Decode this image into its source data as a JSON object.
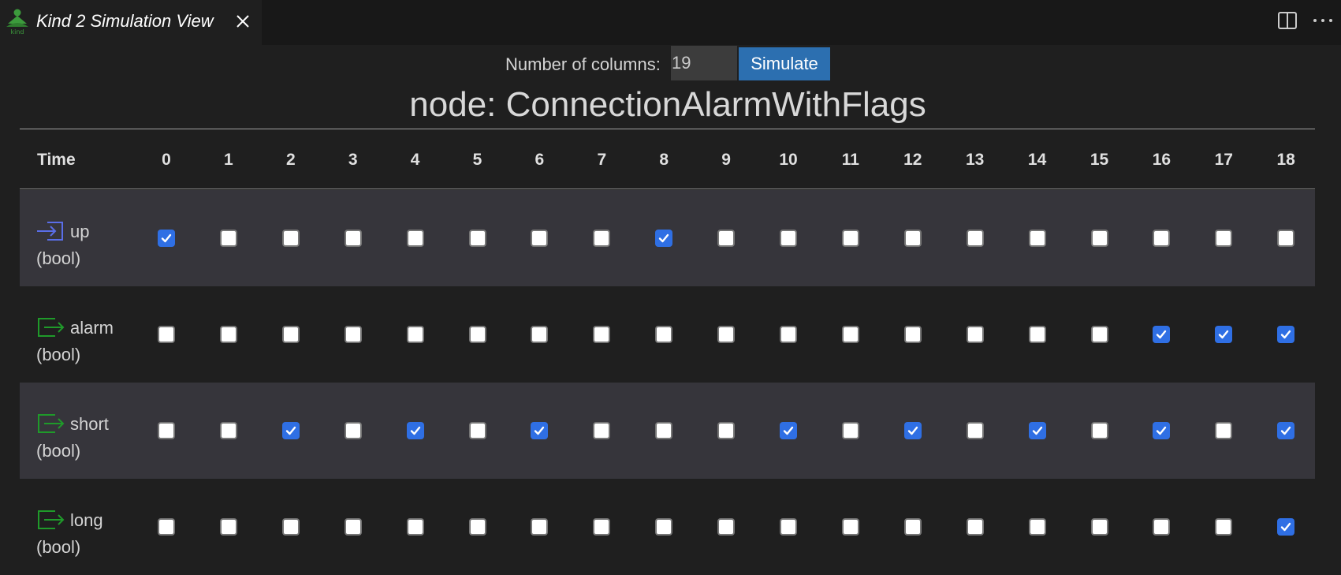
{
  "tab": {
    "title": "Kind 2 Simulation View",
    "logo_text": "kind"
  },
  "controls": {
    "label": "Number of columns:",
    "columns_value": "19",
    "simulate_label": "Simulate"
  },
  "node_title": "node: ConnectionAlarmWithFlags",
  "table": {
    "time_label": "Time",
    "columns": [
      "0",
      "1",
      "2",
      "3",
      "4",
      "5",
      "6",
      "7",
      "8",
      "9",
      "10",
      "11",
      "12",
      "13",
      "14",
      "15",
      "16",
      "17",
      "18"
    ],
    "rows": [
      {
        "name": "up",
        "type": "(bool)",
        "kind": "input",
        "icon": "input-arrow-icon",
        "icon_color": "#5a6ee8",
        "values": [
          true,
          false,
          false,
          false,
          false,
          false,
          false,
          false,
          true,
          false,
          false,
          false,
          false,
          false,
          false,
          false,
          false,
          false,
          false
        ]
      },
      {
        "name": "alarm",
        "type": "(bool)",
        "kind": "output",
        "icon": "output-arrow-icon",
        "icon_color": "#1f9a2a",
        "values": [
          false,
          false,
          false,
          false,
          false,
          false,
          false,
          false,
          false,
          false,
          false,
          false,
          false,
          false,
          false,
          false,
          true,
          true,
          true
        ]
      },
      {
        "name": "short",
        "type": "(bool)",
        "kind": "output",
        "icon": "output-arrow-icon",
        "icon_color": "#1f9a2a",
        "values": [
          false,
          false,
          true,
          false,
          true,
          false,
          true,
          false,
          false,
          false,
          true,
          false,
          true,
          false,
          true,
          false,
          true,
          false,
          true
        ]
      },
      {
        "name": "long",
        "type": "(bool)",
        "kind": "output",
        "icon": "output-arrow-icon",
        "icon_color": "#1f9a2a",
        "values": [
          false,
          false,
          false,
          false,
          false,
          false,
          false,
          false,
          false,
          false,
          false,
          false,
          false,
          false,
          false,
          false,
          false,
          false,
          true
        ]
      }
    ]
  },
  "colors": {
    "background": "#1f1f1f",
    "shaded_row": "#36353b",
    "button": "#2c6fb0",
    "checkbox_checked": "#2f6fe4"
  }
}
